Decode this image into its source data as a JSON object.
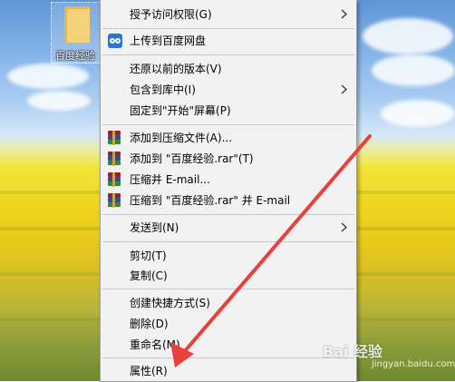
{
  "desktop": {
    "icon_label": "百度经验",
    "watermark_text": "Bai 经验",
    "watermark_sub": "jingyan.baidu.com"
  },
  "context_menu": {
    "items": [
      {
        "label": "授予访问权限(G)",
        "submenu": true
      },
      {
        "label": "上传到百度网盘",
        "icon": "baidu-netdisk-icon"
      },
      {
        "label": "还原以前的版本(V)"
      },
      {
        "label": "包含到库中(I)",
        "submenu": true
      },
      {
        "label": "固定到\"开始\"屏幕(P)"
      },
      {
        "label": "添加到压缩文件(A)...",
        "icon": "winrar-icon"
      },
      {
        "label": "添加到 \"百度经验.rar\"(T)",
        "icon": "winrar-icon"
      },
      {
        "label": "压缩并 E-mail...",
        "icon": "winrar-icon"
      },
      {
        "label": "压缩到 \"百度经验.rar\" 并 E-mail",
        "icon": "winrar-icon"
      },
      {
        "label": "发送到(N)",
        "submenu": true
      },
      {
        "label": "剪切(T)"
      },
      {
        "label": "复制(C)"
      },
      {
        "label": "创建快捷方式(S)"
      },
      {
        "label": "删除(D)"
      },
      {
        "label": "重命名(M)"
      },
      {
        "label": "属性(R)"
      }
    ]
  },
  "annotation": {
    "arrow_color": "#e8403a",
    "target": "属性(R)"
  }
}
